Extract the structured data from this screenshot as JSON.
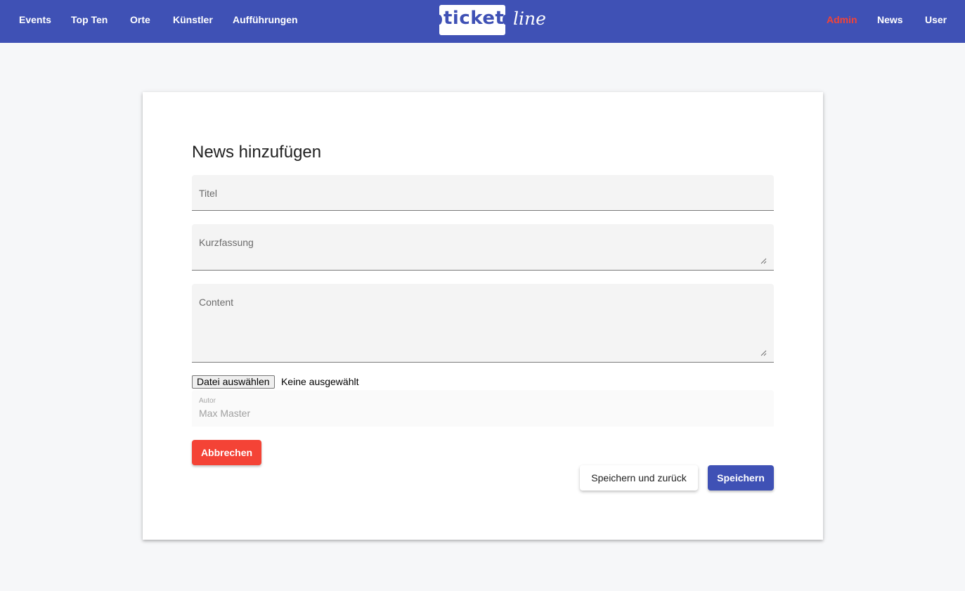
{
  "nav": {
    "left_items": [
      {
        "label": "Events"
      },
      {
        "label": "Top Ten"
      },
      {
        "label": "Orte"
      },
      {
        "label": "Künstler"
      },
      {
        "label": "Aufführungen"
      }
    ],
    "right_items": [
      {
        "label": "Admin"
      },
      {
        "label": "News"
      },
      {
        "label": "User"
      }
    ]
  },
  "logo": {
    "ticket_text": "ticket",
    "line_text": "line"
  },
  "form": {
    "title": "News hinzufügen",
    "fields": {
      "title_label": "Titel",
      "summary_label": "Kurzfassung",
      "content_label": "Content"
    },
    "file": {
      "button_label": "Datei auswählen",
      "status": "Keine ausgewählt"
    },
    "author": {
      "label": "Autor",
      "value": "Max Master"
    },
    "buttons": {
      "cancel": "Abbrechen",
      "save_and_back": "Speichern und zurück",
      "save": "Speichern"
    }
  },
  "colors": {
    "primary": "#3f51b5",
    "warn": "#f44336",
    "background": "#f6f7f9",
    "nav_admin_active": "#f44336"
  }
}
